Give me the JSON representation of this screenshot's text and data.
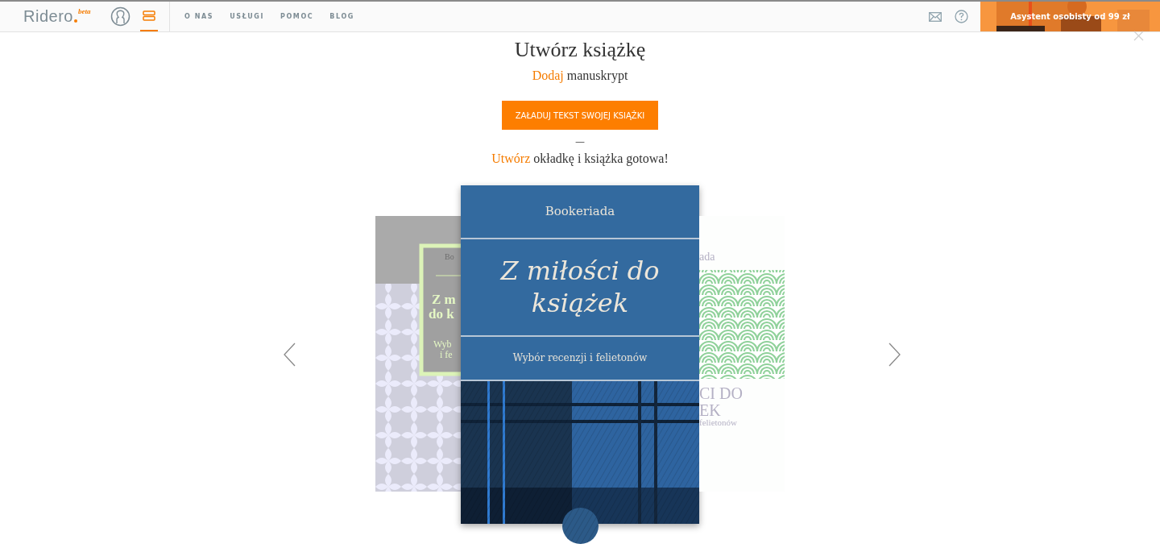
{
  "header": {
    "logo": "Ridero",
    "logo_badge": "beta",
    "nav_links": [
      {
        "label": "O NAS"
      },
      {
        "label": "USŁUGI"
      },
      {
        "label": "POMOC"
      },
      {
        "label": "BLOG"
      }
    ],
    "menu_selected": true,
    "promo": "Asystent osobisty od 99 zł"
  },
  "main": {
    "title": "Utwórz książkę",
    "step1": {
      "accent": "Dodaj",
      "rest": "manuskrypt"
    },
    "upload_button": "ZAŁADUJ TEKST SWOJEJ KSIĄŻKI",
    "separator": "—",
    "step2": {
      "accent": "Utwórz",
      "rest": "okładkę i książka gotowa!"
    }
  },
  "carousel": {
    "left_cover": {
      "texts": [
        "Bo",
        "Z m",
        "do k",
        "Wyb",
        "i fe"
      ]
    },
    "center_cover": {
      "publisher": "Bookeriada",
      "title": "Z miłości do książek",
      "subtitle": "Wybór recenzji i felietonów"
    },
    "right_cover": {
      "texts": [
        "ada",
        "CI DO",
        "EK",
        "felietonów"
      ]
    }
  }
}
